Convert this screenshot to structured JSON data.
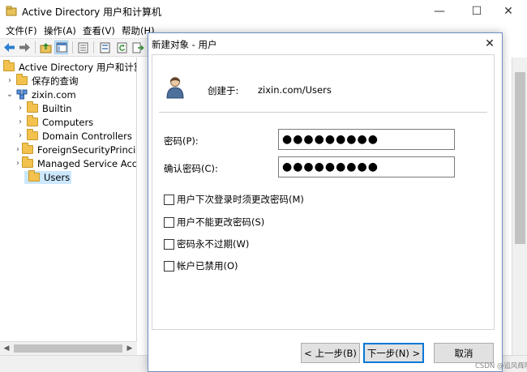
{
  "window": {
    "title": "Active Directory 用户和计算机",
    "minimize_glyph": "—",
    "maximize_glyph": "☐",
    "close_glyph": "✕"
  },
  "menu": {
    "items": [
      {
        "label": "文件(F)"
      },
      {
        "label": "操作(A)"
      },
      {
        "label": "查看(V)"
      },
      {
        "label": "帮助(H)"
      }
    ]
  },
  "toolbar": {
    "icons": [
      "back-arrow-icon",
      "forward-arrow-icon",
      "up-folder-icon",
      "console-tree-icon",
      "properties-icon",
      "export-list-icon",
      "refresh-icon",
      "export-icon"
    ]
  },
  "tree": {
    "root_label": "Active Directory 用户和计算机",
    "saved_queries_label": "保存的查询",
    "domain_label": "zixin.com",
    "children": [
      {
        "label": "Builtin"
      },
      {
        "label": "Computers"
      },
      {
        "label": "Domain Controllers"
      },
      {
        "label": "ForeignSecurityPrincipa"
      },
      {
        "label": "Managed Service Acco"
      },
      {
        "label": "Users"
      }
    ],
    "selected": "Users",
    "expand_glyph": "›",
    "collapse_glyph": "⌄"
  },
  "dialog": {
    "title": "新建对象 - 用户",
    "close_glyph": "✕",
    "created_in_label": "创建于:",
    "created_in_value": "zixin.com/Users",
    "password_label": "密码(P):",
    "password_value": "●●●●●●●●●",
    "confirm_label": "确认密码(C):",
    "confirm_value": "●●●●●●●●●",
    "checkboxes": [
      {
        "label": "用户下次登录时须更改密码(M)",
        "checked": false
      },
      {
        "label": "用户不能更改密码(S)",
        "checked": false
      },
      {
        "label": "密码永不过期(W)",
        "checked": false
      },
      {
        "label": "帐户已禁用(O)",
        "checked": false
      }
    ],
    "buttons": {
      "back": "< 上一步(B)",
      "next": "下一步(N) >",
      "cancel": "取消"
    }
  },
  "watermark": "CSDN @追风辉明月",
  "colors": {
    "accent": "#0078d7",
    "selection": "#cce8ff",
    "folder": "#f2c14e"
  }
}
